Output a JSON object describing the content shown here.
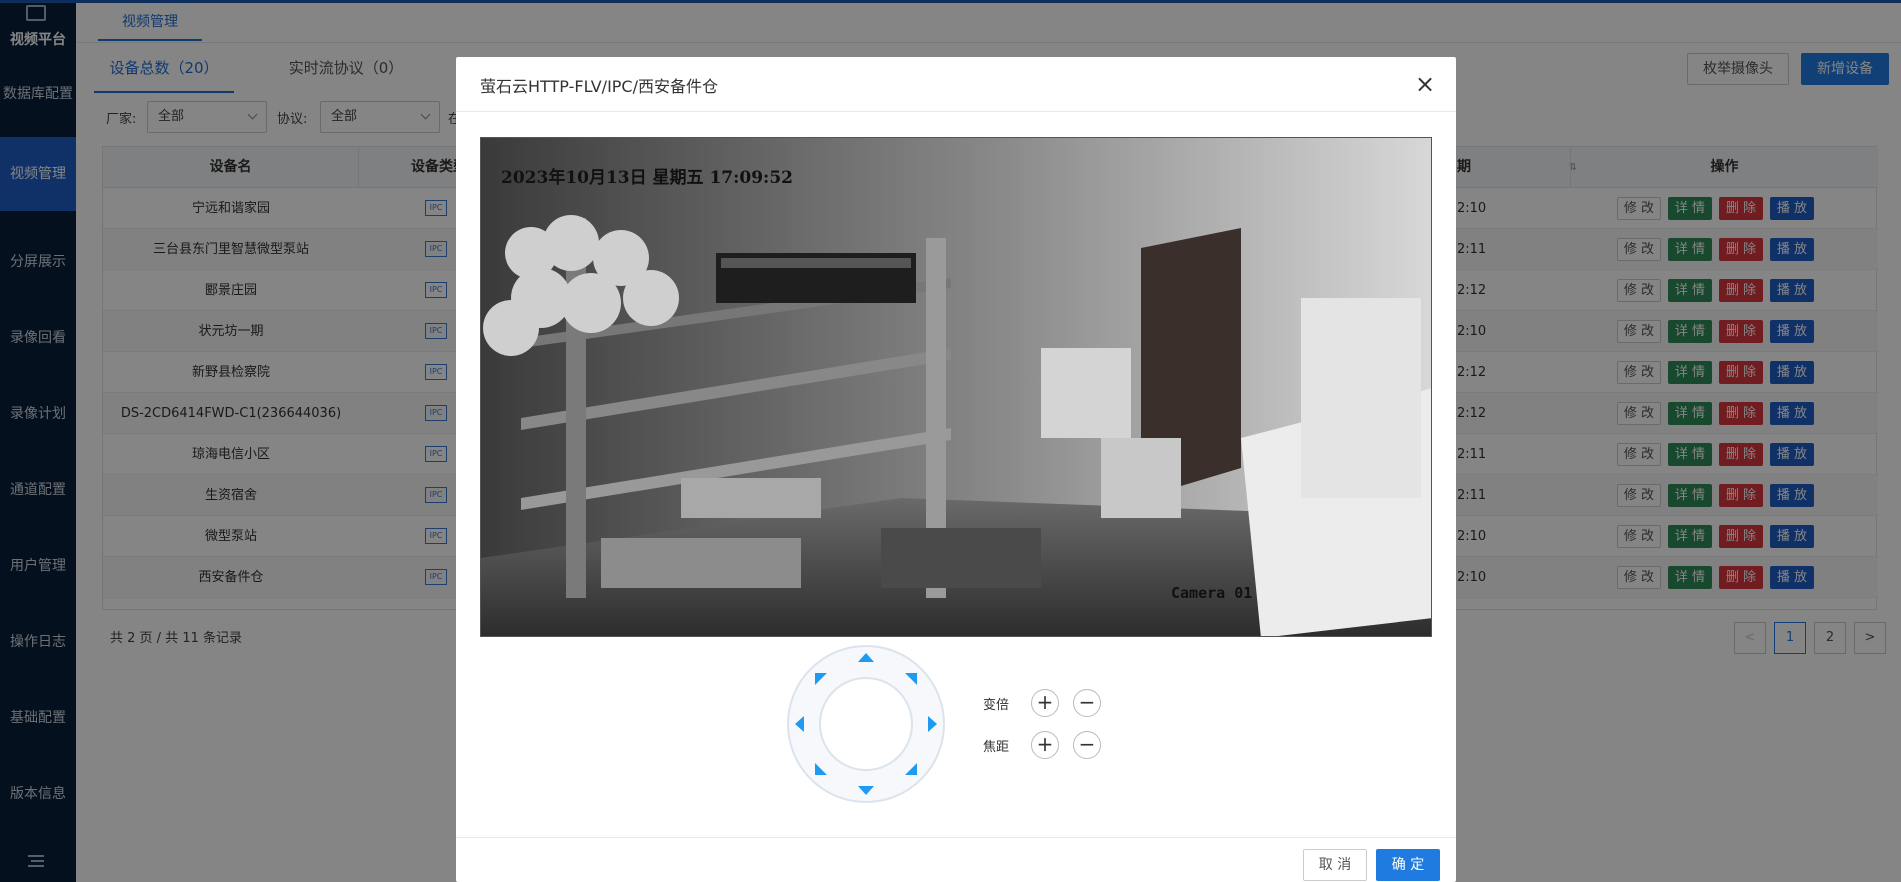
{
  "sidebar": {
    "items": [
      {
        "label": "视频平台"
      },
      {
        "label": "数据库配置"
      },
      {
        "label": "视频管理"
      },
      {
        "label": "分屏展示"
      },
      {
        "label": "录像回看"
      },
      {
        "label": "录像计划"
      },
      {
        "label": "通道配置"
      },
      {
        "label": "用户管理"
      },
      {
        "label": "操作日志"
      },
      {
        "label": "基础配置"
      },
      {
        "label": "版本信息"
      }
    ],
    "active": "视频管理"
  },
  "header": {
    "tab": "视频管理"
  },
  "subtabs": {
    "total": "设备总数（20）",
    "protocol": "实时流协议（0）"
  },
  "toolbar": {
    "enumerate": "枚举摄像头",
    "add": "新增设备"
  },
  "filters": {
    "vendor_label": "厂家:",
    "vendor_value": "全部",
    "protocol_label": "协议:",
    "protocol_value": "全部",
    "extra_label": "在"
  },
  "table": {
    "headers": {
      "name": "设备名",
      "type": "设备类型",
      "date": "期",
      "ops": "操作"
    },
    "type_badge": "IPC",
    "ops": {
      "edit": "修 改",
      "detail": "详 情",
      "delete": "删 除",
      "play": "播 放"
    },
    "rows": [
      {
        "name": "宁远和谐家园",
        "time": "2:10"
      },
      {
        "name": "三台县东门里智慧微型泵站",
        "time": "2:11"
      },
      {
        "name": "郾景庄园",
        "time": "2:12"
      },
      {
        "name": "状元坊一期",
        "time": "2:10"
      },
      {
        "name": "新野县检察院",
        "time": "2:12"
      },
      {
        "name": "DS-2CD6414FWD-C1(236644036)",
        "time": "2:12"
      },
      {
        "name": "琼海电信小区",
        "time": "2:11"
      },
      {
        "name": "生资宿舍",
        "time": "2:11"
      },
      {
        "name": "微型泵站",
        "time": "2:10"
      },
      {
        "name": "西安备件仓",
        "time": "2:10"
      }
    ]
  },
  "pagination": {
    "summary": "共 2 页 / 共 11 条记录",
    "prev": "<",
    "page1": "1",
    "page2": "2",
    "next": ">"
  },
  "modal": {
    "title": "萤石云HTTP-FLV/IPC/西安备件仓",
    "close": "×",
    "video": {
      "timestamp": "2023年10月13日 星期五 17:09:52",
      "camera": "Camera 01"
    },
    "zoom_label": "变倍",
    "focus_label": "焦距",
    "plus": "+",
    "minus": "−",
    "cancel": "取 消",
    "confirm": "确 定"
  },
  "colors": {
    "accent": "#1f7be0",
    "sidebar": "#0b1f3d",
    "danger": "#d9363e",
    "success": "#2e8b57"
  }
}
